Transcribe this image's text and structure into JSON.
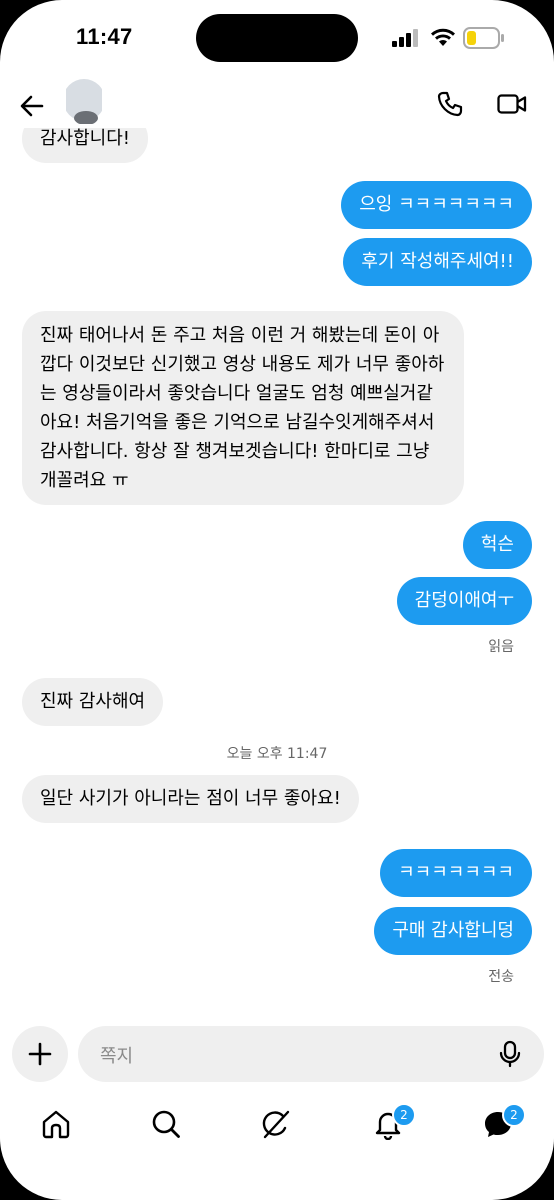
{
  "status_bar": {
    "time": "11:47"
  },
  "conversation": {
    "messages": [
      {
        "dir": "in",
        "text": "감사합니다!"
      },
      {
        "dir": "out",
        "text": "으잉 ㅋㅋㅋㅋㅋㅋㅋ"
      },
      {
        "dir": "out",
        "text": "후기 작성해주세여!!"
      },
      {
        "dir": "in",
        "text": "진짜 태어나서 돈 주고 처음 이런 거 해봤는데 돈이 아깝다 이것보단 신기했고 영상 내용도 제가 너무 좋아하는 영상들이라서 좋앗습니다 얼굴도 엄청 예쁘실거같아요! 처음기억을 좋은 기억으로 남길수잇게해주셔서 감사합니다. 항상 잘 챙겨보겟습니다! 한마디로 그냥 개꼴려요 ㅠ"
      },
      {
        "dir": "out",
        "text": "헉슨"
      },
      {
        "dir": "out",
        "text": "감덩이애여ㅜ"
      },
      {
        "dir": "in",
        "text": "진짜 감사해여"
      },
      {
        "dir": "in",
        "text": "일단 사기가 아니라는 점이 너무 좋아요!"
      },
      {
        "dir": "out",
        "text": "ㅋㅋㅋㅋㅋㅋㅋ"
      },
      {
        "dir": "out",
        "text": "구매 감사합니덩"
      }
    ],
    "read_receipt": "읽음",
    "timestamp": "오늘 오후 11:47",
    "sent_receipt": "전송"
  },
  "composer": {
    "placeholder": "쪽지"
  },
  "nav": {
    "notifications_badge": "2",
    "messages_badge": "2"
  },
  "colors": {
    "accent": "#1d9bf0",
    "bubble_in": "#efefef"
  },
  "icons": [
    "back-icon",
    "phone-icon",
    "video-icon",
    "plus-icon",
    "mic-icon",
    "home-icon",
    "search-icon",
    "grok-icon",
    "bell-icon",
    "messages-icon"
  ]
}
